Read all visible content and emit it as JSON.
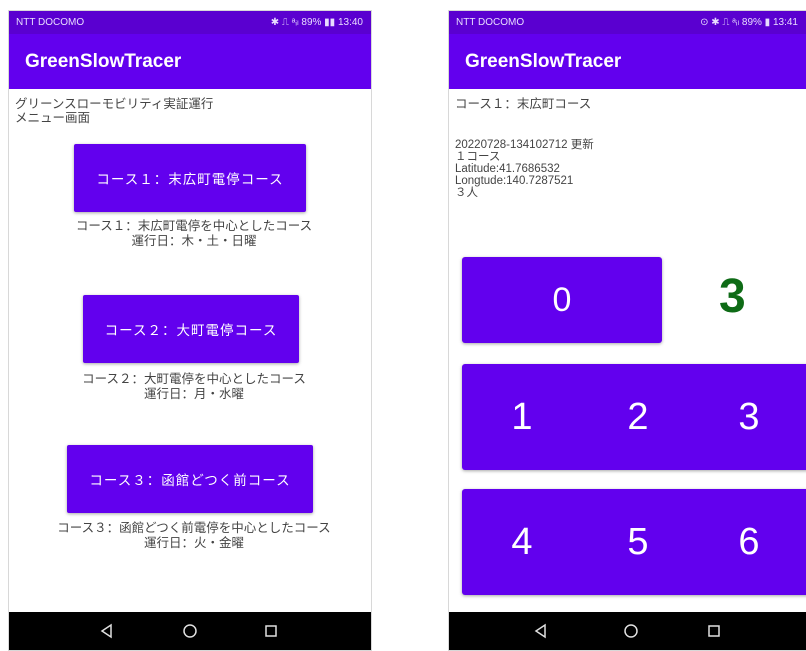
{
  "left_screen": {
    "status": {
      "carrier": "NTT DOCOMO",
      "system": "✱ ⎍ ᵃᵢₗ 89% ▮▮ 13:40"
    },
    "app_title": "GreenSlowTracer",
    "header": "グリーンスローモビリティ実証運行\nメニュー画面",
    "courses": [
      {
        "label": "コース１：末広町電停コース",
        "desc": "コース１：末広町電停を中心としたコース\n運行日：木・土・日曜"
      },
      {
        "label": "コース２：大町電停コース",
        "desc": "コース２：大町電停を中心としたコース\n運行日：月・水曜"
      },
      {
        "label": "コース３：函館どつく前コース",
        "desc": "コース３：函館どつく前電停を中心としたコース\n運行日：火・金曜"
      }
    ]
  },
  "right_screen": {
    "status": {
      "carrier": "NTT DOCOMO",
      "system": "⊙ ✱ ⎍ ᵃᵢₗ 89% ▮ 13:41"
    },
    "app_title": "GreenSlowTracer",
    "course_title": "コース１：末広町コース",
    "info": {
      "updated": "20220728-134102712 更新",
      "course": "１コース",
      "latitude": "Latitude:41.7686532",
      "longitude": "Longtude:140.7287521",
      "people": "３人"
    },
    "reset_key": "0",
    "count": "3",
    "keys_row1": [
      "1",
      "2",
      "3"
    ],
    "keys_row2": [
      "4",
      "5",
      "6"
    ]
  },
  "nav": {
    "icons": [
      "back-icon",
      "home-icon",
      "recents-icon"
    ]
  }
}
